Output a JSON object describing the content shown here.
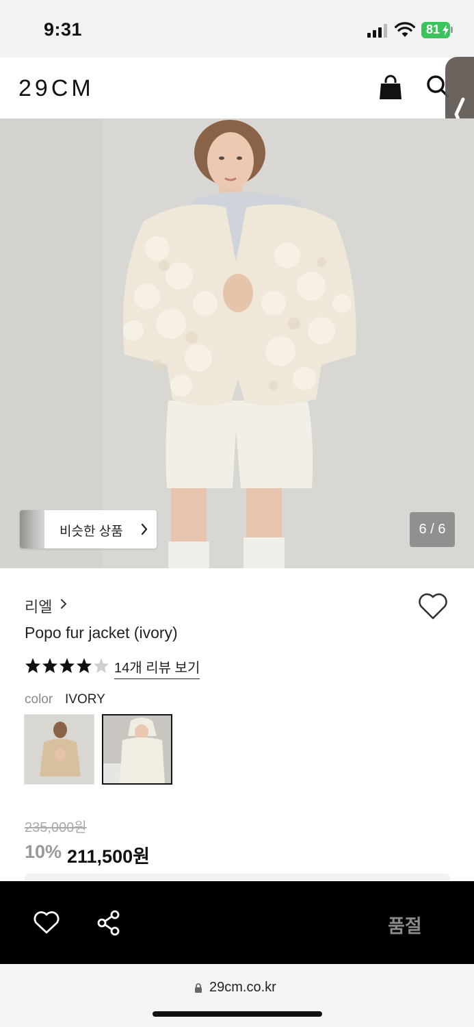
{
  "status": {
    "time": "9:31",
    "battery": "81"
  },
  "header": {
    "logo": "29CM",
    "icons": [
      "shopping-bag-icon",
      "search-icon"
    ]
  },
  "gallery": {
    "similar_label": "비슷한 상품",
    "counter": "6 / 6"
  },
  "product": {
    "brand": "리엘",
    "title": "Popo fur jacket (ivory)",
    "rating": 4.5,
    "rating_max": 5,
    "review_link": "14개 리뷰 보기",
    "color_label": "color",
    "color_value": "IVORY",
    "original_price": "235,000원",
    "discount": "10%",
    "price": "211,500원"
  },
  "bottom_bar": {
    "soldout_label": "품절"
  },
  "browser": {
    "url": "29cm.co.kr"
  },
  "colors": {
    "battery": "#3bc45b",
    "bottom_bar": "#000000",
    "side_tab": "#5f5650"
  }
}
